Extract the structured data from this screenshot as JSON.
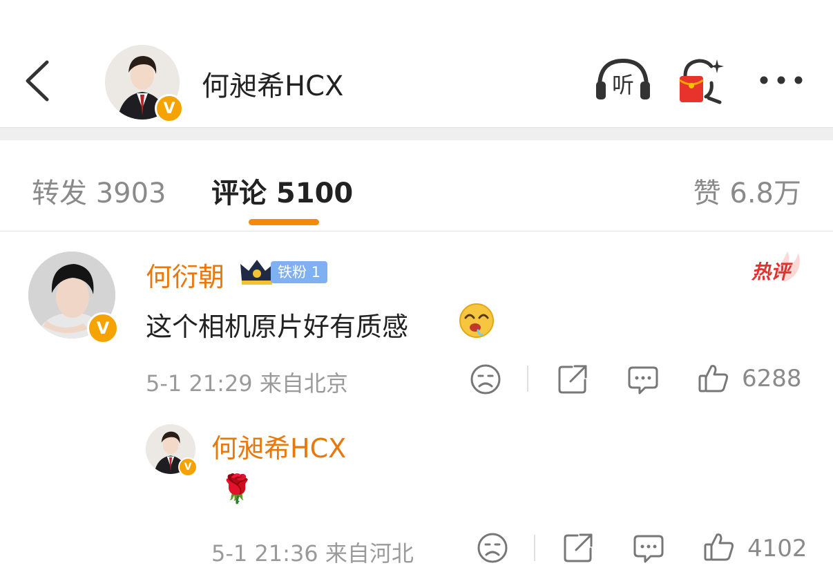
{
  "header": {
    "title": "何昶希HCX",
    "listen_label": "听"
  },
  "tabs": {
    "repost": "转发 3903",
    "comments": "评论 5100",
    "likes": "赞 6.8万"
  },
  "comment": {
    "username": "何衍朝",
    "fan_badge": "铁粉 1",
    "hot_badge": "热评",
    "text": "这个相机原片好有质感",
    "meta": "5-1 21:29 来自北京",
    "like_count": "6288"
  },
  "reply": {
    "username": "何昶希HCX",
    "text": "🌹",
    "meta": "5-1 21:36 来自河北",
    "like_count": "4102"
  },
  "colors": {
    "accent": "#e7780c",
    "tab_indicator": "#f5890b",
    "verified_badge": "#f5a300",
    "fan_badge": "#7fb0f2",
    "hot_red": "#e0332f"
  }
}
